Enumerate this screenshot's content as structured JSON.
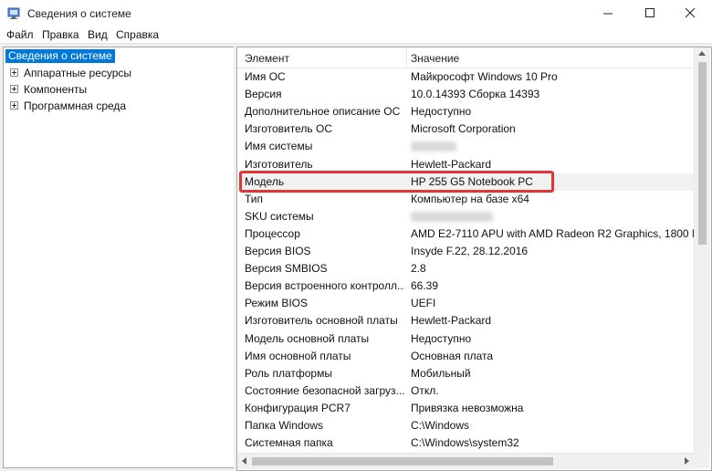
{
  "window": {
    "title": "Сведения о системе",
    "icon": "system-info-icon"
  },
  "menu": [
    {
      "label": "Файл",
      "hotkey": "Ф"
    },
    {
      "label": "Правка",
      "hotkey": "П"
    },
    {
      "label": "Вид",
      "hotkey": "В"
    },
    {
      "label": "Справка",
      "hotkey": "С"
    }
  ],
  "tree": {
    "root": "Сведения о системе",
    "children": [
      "Аппаратные ресурсы",
      "Компоненты",
      "Программная среда"
    ]
  },
  "table": {
    "columns": [
      "Элемент",
      "Значение"
    ],
    "rows": [
      {
        "item": "Имя ОС",
        "value": "Майкрософт Windows 10 Pro"
      },
      {
        "item": "Версия",
        "value": "10.0.14393 Сборка 14393"
      },
      {
        "item": "Дополнительное описание ОС",
        "value": "Недоступно"
      },
      {
        "item": "Изготовитель ОС",
        "value": "Microsoft Corporation"
      },
      {
        "item": "Имя системы",
        "value": "",
        "redacted": true
      },
      {
        "item": "Изготовитель",
        "value": "Hewlett-Packard"
      },
      {
        "item": "Модель",
        "value": "HP 255 G5 Notebook PC",
        "highlighted": true
      },
      {
        "item": "Тип",
        "value": "Компьютер на базе x64"
      },
      {
        "item": "SKU системы",
        "value": "",
        "redacted": true
      },
      {
        "item": "Процессор",
        "value": "AMD E2-7110 APU with AMD Radeon R2 Graphics, 1800 M"
      },
      {
        "item": "Версия BIOS",
        "value": "Insyde F.22, 28.12.2016"
      },
      {
        "item": "Версия SMBIOS",
        "value": "2.8"
      },
      {
        "item": "Версия встроенного контролл...",
        "value": "66.39"
      },
      {
        "item": "Режим BIOS",
        "value": "UEFI"
      },
      {
        "item": "Изготовитель основной платы",
        "value": "Hewlett-Packard"
      },
      {
        "item": "Модель основной платы",
        "value": "Недоступно"
      },
      {
        "item": "Имя основной платы",
        "value": "Основная плата"
      },
      {
        "item": "Роль платформы",
        "value": "Мобильный"
      },
      {
        "item": "Состояние безопасной загруз...",
        "value": "Откл."
      },
      {
        "item": "Конфигурация PCR7",
        "value": "Привязка невозможна"
      },
      {
        "item": "Папка Windows",
        "value": "C:\\Windows"
      },
      {
        "item": "Системная папка",
        "value": "C:\\Windows\\system32"
      }
    ]
  },
  "colors": {
    "selection": "#0078d7",
    "highlight_border": "#e03535"
  }
}
